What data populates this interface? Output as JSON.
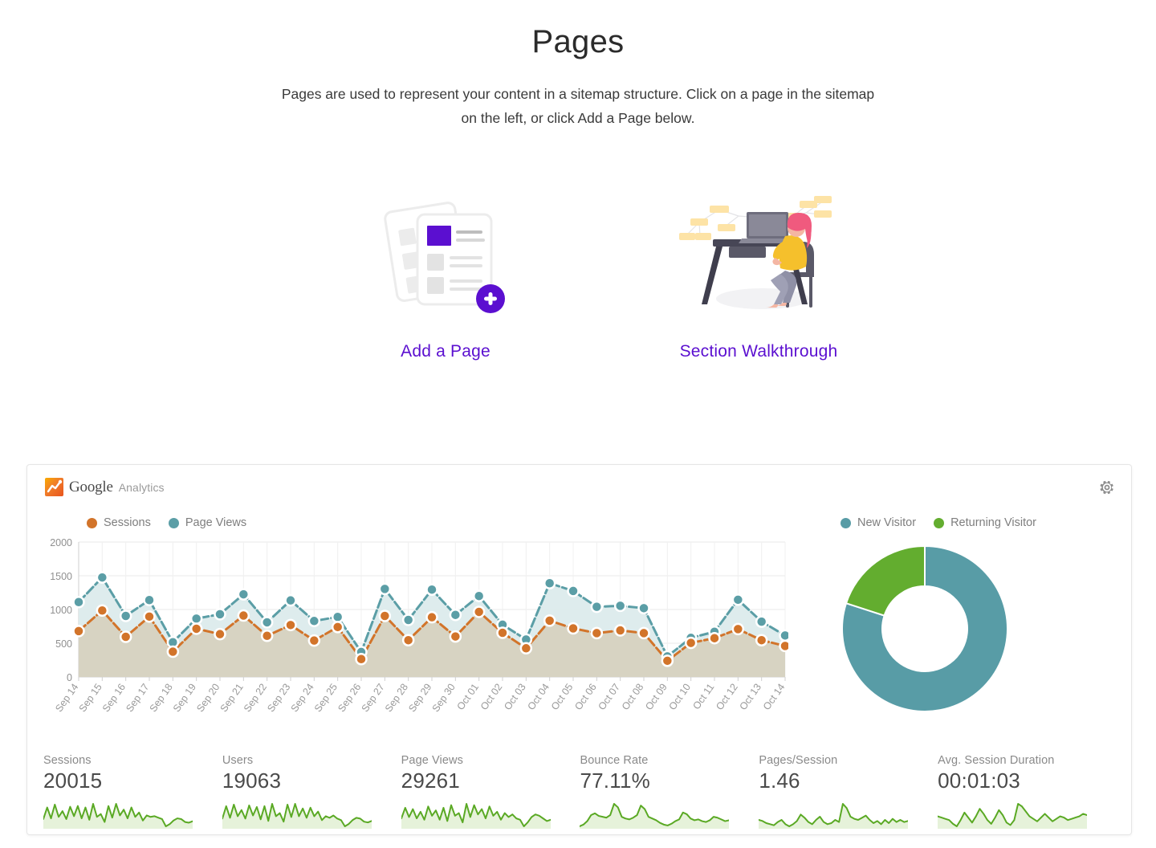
{
  "header": {
    "title": "Pages",
    "description": "Pages are used to represent your content in a sitemap structure. Click on a page in the sitemap on the left, or click Add a Page below."
  },
  "actions": [
    {
      "label": "Add a Page",
      "icon": "add-page-illustration"
    },
    {
      "label": "Section Walkthrough",
      "icon": "walkthrough-illustration"
    }
  ],
  "analytics": {
    "brand_primary": "Google",
    "brand_secondary": "Analytics",
    "settings_icon": "gear-icon",
    "colors": {
      "sessions": "#d2742a",
      "page_views": "#5b9ea6",
      "new_visitor": "#589ca6",
      "returning_visitor": "#63ad2f",
      "sparkline": "#5aa924",
      "sparkline_fill": "#e6f2da",
      "sessions_area": "#d6d2c0",
      "page_views_area": "#dcebec"
    },
    "metrics": [
      {
        "label": "Sessions",
        "value": "20015"
      },
      {
        "label": "Users",
        "value": "19063"
      },
      {
        "label": "Page Views",
        "value": "29261"
      },
      {
        "label": "Bounce Rate",
        "value": "77.11%"
      },
      {
        "label": "Pages/Session",
        "value": "1.46"
      },
      {
        "label": "Avg. Session Duration",
        "value": "00:01:03"
      }
    ]
  },
  "chart_data": [
    {
      "type": "line",
      "title": "",
      "xlabel": "",
      "ylabel": "",
      "ylim": [
        0,
        2000
      ],
      "yticks": [
        0,
        500,
        1000,
        1500,
        2000
      ],
      "grid": true,
      "legend_position": "top-left",
      "categories": [
        "Sep 14",
        "Sep 15",
        "Sep 16",
        "Sep 17",
        "Sep 18",
        "Sep 19",
        "Sep 20",
        "Sep 21",
        "Sep 22",
        "Sep 23",
        "Sep 24",
        "Sep 25",
        "Sep 26",
        "Sep 27",
        "Sep 28",
        "Sep 29",
        "Sep 30",
        "Oct 01",
        "Oct 02",
        "Oct 03",
        "Oct 04",
        "Oct 05",
        "Oct 06",
        "Oct 07",
        "Oct 08",
        "Oct 09",
        "Oct 10",
        "Oct 11",
        "Oct 12",
        "Oct 13",
        "Oct 14"
      ],
      "series": [
        {
          "name": "Page Views",
          "color": "#5b9ea6",
          "values": [
            1110,
            1475,
            905,
            1140,
            515,
            865,
            930,
            1225,
            810,
            1135,
            830,
            890,
            370,
            1305,
            845,
            1295,
            920,
            1200,
            775,
            555,
            1390,
            1275,
            1040,
            1055,
            1020,
            305,
            580,
            670,
            1145,
            820,
            615
          ]
        },
        {
          "name": "Sessions",
          "color": "#d2742a",
          "values": [
            680,
            985,
            595,
            895,
            375,
            715,
            635,
            910,
            610,
            770,
            540,
            740,
            265,
            905,
            545,
            885,
            600,
            965,
            655,
            425,
            835,
            720,
            650,
            690,
            650,
            240,
            505,
            575,
            710,
            545,
            460
          ]
        }
      ]
    },
    {
      "type": "pie",
      "title": "",
      "donut": true,
      "legend_position": "top",
      "categories": [
        "New Visitor",
        "Returning Visitor"
      ],
      "values": [
        80,
        20
      ],
      "colors": [
        "#589ca6",
        "#63ad2f"
      ]
    },
    {
      "type": "line",
      "title": "Sessions sparkline",
      "values": [
        38,
        70,
        40,
        78,
        44,
        60,
        38,
        72,
        46,
        74,
        40,
        70,
        36,
        80,
        44,
        52,
        30,
        74,
        42,
        80,
        48,
        64,
        40,
        70,
        44,
        56,
        34,
        48,
        44,
        46,
        42,
        38,
        18,
        24,
        34,
        40,
        38,
        30,
        28,
        32
      ],
      "ylim": [
        0,
        100
      ]
    },
    {
      "type": "line",
      "title": "Users sparkline",
      "values": [
        40,
        72,
        42,
        76,
        46,
        62,
        40,
        74,
        48,
        70,
        38,
        72,
        34,
        78,
        46,
        54,
        32,
        76,
        44,
        78,
        46,
        66,
        42,
        68,
        46,
        58,
        36,
        46,
        42,
        48,
        40,
        36,
        20,
        26,
        36,
        42,
        40,
        32,
        30,
        34
      ],
      "ylim": [
        0,
        100
      ]
    },
    {
      "type": "line",
      "title": "Page Views sparkline",
      "values": [
        36,
        52,
        38,
        50,
        36,
        46,
        34,
        54,
        40,
        48,
        34,
        52,
        32,
        56,
        40,
        44,
        30,
        58,
        38,
        56,
        42,
        50,
        36,
        54,
        40,
        46,
        34,
        44,
        38,
        42,
        36,
        34,
        24,
        30,
        38,
        42,
        40,
        36,
        32,
        34
      ]
    },
    {
      "type": "line",
      "title": "Bounce Rate sparkline",
      "values": [
        18,
        22,
        30,
        44,
        48,
        42,
        40,
        38,
        44,
        70,
        62,
        40,
        36,
        34,
        38,
        44,
        66,
        58,
        40,
        36,
        32,
        26,
        22,
        20,
        24,
        30,
        34,
        50,
        46,
        36,
        32,
        34,
        30,
        28,
        32,
        40,
        38,
        34,
        30,
        32
      ]
    },
    {
      "type": "line",
      "title": "Pages/Session sparkline",
      "values": [
        34,
        32,
        28,
        26,
        24,
        30,
        34,
        26,
        22,
        26,
        32,
        44,
        38,
        30,
        26,
        34,
        40,
        30,
        26,
        28,
        34,
        30,
        64,
        56,
        40,
        36,
        34,
        38,
        42,
        34,
        28,
        32,
        26,
        34,
        28,
        36,
        30,
        34,
        30,
        32
      ]
    },
    {
      "type": "line",
      "title": "Avg. Session Duration sparkline",
      "values": [
        40,
        38,
        36,
        34,
        28,
        24,
        34,
        46,
        38,
        30,
        40,
        52,
        44,
        34,
        28,
        38,
        50,
        42,
        30,
        26,
        34,
        60,
        56,
        48,
        40,
        36,
        32,
        38,
        44,
        38,
        32,
        36,
        40,
        38,
        34,
        36,
        38,
        40,
        44,
        42
      ]
    }
  ]
}
